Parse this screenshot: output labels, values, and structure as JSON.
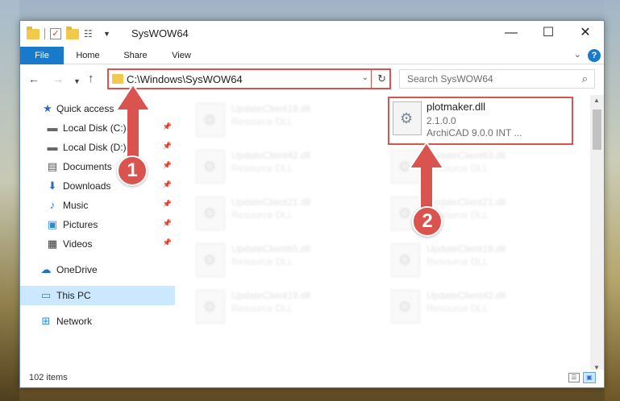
{
  "window": {
    "title": "SysWOW64",
    "minimize_glyph": "—",
    "maximize_glyph": "☐",
    "close_glyph": "✕"
  },
  "ribbon": {
    "tabs": [
      "File",
      "Home",
      "Share",
      "View"
    ],
    "help_glyph": "?"
  },
  "nav": {
    "address": "C:\\Windows\\SysWOW64",
    "search_placeholder": "Search SysWOW64"
  },
  "sidebar": {
    "items": [
      {
        "label": "Quick access",
        "icon": "star-icon",
        "pinned": false
      },
      {
        "label": "Local Disk (C:)",
        "icon": "disk-icon",
        "pinned": true
      },
      {
        "label": "Local Disk (D:)",
        "icon": "disk-icon",
        "pinned": true
      },
      {
        "label": "Documents",
        "icon": "documents-icon",
        "pinned": true
      },
      {
        "label": "Downloads",
        "icon": "download-icon",
        "pinned": true
      },
      {
        "label": "Music",
        "icon": "music-icon",
        "pinned": true
      },
      {
        "label": "Pictures",
        "icon": "pictures-icon",
        "pinned": true
      },
      {
        "label": "Videos",
        "icon": "videos-icon",
        "pinned": true
      },
      {
        "label": "OneDrive",
        "icon": "cloud-icon",
        "pinned": false
      },
      {
        "label": "This PC",
        "icon": "pc-icon",
        "pinned": false,
        "selected": true
      },
      {
        "label": "Network",
        "icon": "network-icon",
        "pinned": false
      }
    ]
  },
  "files": {
    "left_column": [
      {
        "name": "UpdateClient19.dll",
        "type": "Resource DLL"
      },
      {
        "name": "UpdateClient42.dll",
        "type": "Resource DLL"
      },
      {
        "name": "UpdateClient21.dll",
        "type": "Resource DLL"
      },
      {
        "name": "UpdateClient65.dll",
        "type": "Resource DLL"
      },
      {
        "name": "UpdateClient19.dll",
        "type": "Resource DLL"
      }
    ],
    "right_column": [
      {
        "name": "UpdateClient63.dll",
        "type": "Resource DLL"
      },
      {
        "name": "UpdateClient21.dll",
        "type": "Resource DLL"
      },
      {
        "name": "UpdateClient19.dll",
        "type": "Resource DLL"
      },
      {
        "name": "UpdateClient42.dll",
        "type": "Resource DLL"
      }
    ],
    "highlighted": {
      "name": "plotmaker.dll",
      "version": "2.1.0.0",
      "description": "ArchiCAD 9.0.0 INT ..."
    }
  },
  "status": {
    "item_count": "102 items"
  },
  "annotations": {
    "badge_1": "1",
    "badge_2": "2",
    "color": "#d9534f"
  }
}
